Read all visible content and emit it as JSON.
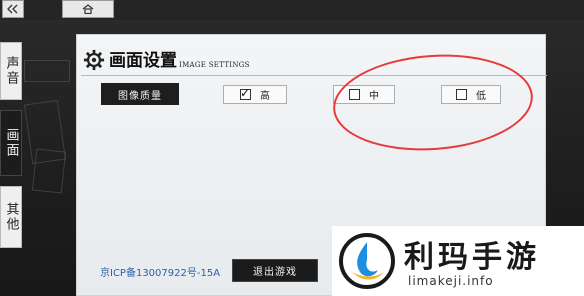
{
  "top_bar": {
    "back_icon": "double-chevron-left-icon",
    "home_icon": "home-icon"
  },
  "side_tabs": [
    {
      "label": "声音",
      "active": false
    },
    {
      "label": "画面",
      "active": true
    },
    {
      "label": "其他",
      "active": false
    }
  ],
  "panel": {
    "title": "画面设置",
    "subtitle": "IMAGE SETTINGS",
    "row_label": "图像质量",
    "options": [
      {
        "label": "高",
        "checked": true
      },
      {
        "label": "中",
        "checked": false
      },
      {
        "label": "低",
        "checked": false
      }
    ]
  },
  "footer": {
    "icp": "京ICP备13007922号-15A",
    "exit_label": "退出游戏"
  },
  "watermark": {
    "title": "利玛手游",
    "url": "limakeji.info"
  },
  "colors": {
    "annotation_ellipse": "#e53b3b",
    "icp_link": "#2d5fa8",
    "panel_bg": "#eef1f3"
  }
}
